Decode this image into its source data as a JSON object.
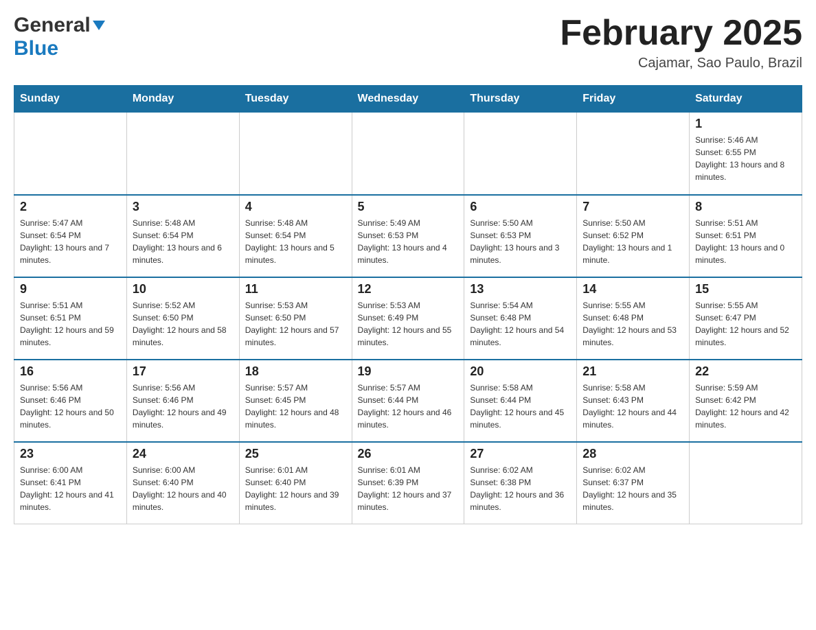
{
  "header": {
    "logo_general": "General",
    "logo_blue": "Blue",
    "title": "February 2025",
    "subtitle": "Cajamar, Sao Paulo, Brazil"
  },
  "days_of_week": [
    "Sunday",
    "Monday",
    "Tuesday",
    "Wednesday",
    "Thursday",
    "Friday",
    "Saturday"
  ],
  "weeks": [
    [
      {
        "day": "",
        "info": ""
      },
      {
        "day": "",
        "info": ""
      },
      {
        "day": "",
        "info": ""
      },
      {
        "day": "",
        "info": ""
      },
      {
        "day": "",
        "info": ""
      },
      {
        "day": "",
        "info": ""
      },
      {
        "day": "1",
        "info": "Sunrise: 5:46 AM\nSunset: 6:55 PM\nDaylight: 13 hours and 8 minutes."
      }
    ],
    [
      {
        "day": "2",
        "info": "Sunrise: 5:47 AM\nSunset: 6:54 PM\nDaylight: 13 hours and 7 minutes."
      },
      {
        "day": "3",
        "info": "Sunrise: 5:48 AM\nSunset: 6:54 PM\nDaylight: 13 hours and 6 minutes."
      },
      {
        "day": "4",
        "info": "Sunrise: 5:48 AM\nSunset: 6:54 PM\nDaylight: 13 hours and 5 minutes."
      },
      {
        "day": "5",
        "info": "Sunrise: 5:49 AM\nSunset: 6:53 PM\nDaylight: 13 hours and 4 minutes."
      },
      {
        "day": "6",
        "info": "Sunrise: 5:50 AM\nSunset: 6:53 PM\nDaylight: 13 hours and 3 minutes."
      },
      {
        "day": "7",
        "info": "Sunrise: 5:50 AM\nSunset: 6:52 PM\nDaylight: 13 hours and 1 minute."
      },
      {
        "day": "8",
        "info": "Sunrise: 5:51 AM\nSunset: 6:51 PM\nDaylight: 13 hours and 0 minutes."
      }
    ],
    [
      {
        "day": "9",
        "info": "Sunrise: 5:51 AM\nSunset: 6:51 PM\nDaylight: 12 hours and 59 minutes."
      },
      {
        "day": "10",
        "info": "Sunrise: 5:52 AM\nSunset: 6:50 PM\nDaylight: 12 hours and 58 minutes."
      },
      {
        "day": "11",
        "info": "Sunrise: 5:53 AM\nSunset: 6:50 PM\nDaylight: 12 hours and 57 minutes."
      },
      {
        "day": "12",
        "info": "Sunrise: 5:53 AM\nSunset: 6:49 PM\nDaylight: 12 hours and 55 minutes."
      },
      {
        "day": "13",
        "info": "Sunrise: 5:54 AM\nSunset: 6:48 PM\nDaylight: 12 hours and 54 minutes."
      },
      {
        "day": "14",
        "info": "Sunrise: 5:55 AM\nSunset: 6:48 PM\nDaylight: 12 hours and 53 minutes."
      },
      {
        "day": "15",
        "info": "Sunrise: 5:55 AM\nSunset: 6:47 PM\nDaylight: 12 hours and 52 minutes."
      }
    ],
    [
      {
        "day": "16",
        "info": "Sunrise: 5:56 AM\nSunset: 6:46 PM\nDaylight: 12 hours and 50 minutes."
      },
      {
        "day": "17",
        "info": "Sunrise: 5:56 AM\nSunset: 6:46 PM\nDaylight: 12 hours and 49 minutes."
      },
      {
        "day": "18",
        "info": "Sunrise: 5:57 AM\nSunset: 6:45 PM\nDaylight: 12 hours and 48 minutes."
      },
      {
        "day": "19",
        "info": "Sunrise: 5:57 AM\nSunset: 6:44 PM\nDaylight: 12 hours and 46 minutes."
      },
      {
        "day": "20",
        "info": "Sunrise: 5:58 AM\nSunset: 6:44 PM\nDaylight: 12 hours and 45 minutes."
      },
      {
        "day": "21",
        "info": "Sunrise: 5:58 AM\nSunset: 6:43 PM\nDaylight: 12 hours and 44 minutes."
      },
      {
        "day": "22",
        "info": "Sunrise: 5:59 AM\nSunset: 6:42 PM\nDaylight: 12 hours and 42 minutes."
      }
    ],
    [
      {
        "day": "23",
        "info": "Sunrise: 6:00 AM\nSunset: 6:41 PM\nDaylight: 12 hours and 41 minutes."
      },
      {
        "day": "24",
        "info": "Sunrise: 6:00 AM\nSunset: 6:40 PM\nDaylight: 12 hours and 40 minutes."
      },
      {
        "day": "25",
        "info": "Sunrise: 6:01 AM\nSunset: 6:40 PM\nDaylight: 12 hours and 39 minutes."
      },
      {
        "day": "26",
        "info": "Sunrise: 6:01 AM\nSunset: 6:39 PM\nDaylight: 12 hours and 37 minutes."
      },
      {
        "day": "27",
        "info": "Sunrise: 6:02 AM\nSunset: 6:38 PM\nDaylight: 12 hours and 36 minutes."
      },
      {
        "day": "28",
        "info": "Sunrise: 6:02 AM\nSunset: 6:37 PM\nDaylight: 12 hours and 35 minutes."
      },
      {
        "day": "",
        "info": ""
      }
    ]
  ]
}
